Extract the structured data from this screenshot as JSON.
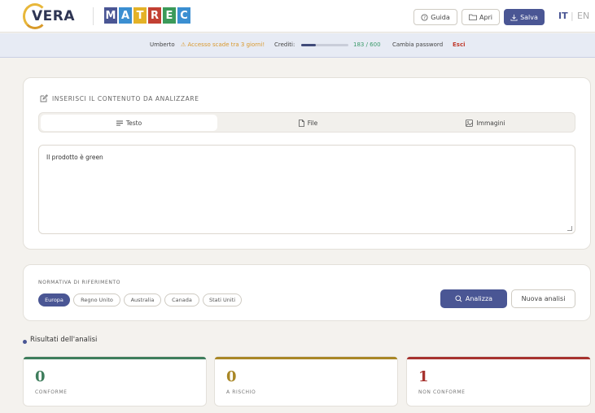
{
  "header": {
    "vera_logo_text": "VERA",
    "matrec_letters": [
      {
        "char": "M",
        "color": "#4a5694"
      },
      {
        "char": "A",
        "color": "#3b8fd1"
      },
      {
        "char": "T",
        "color": "#e4b227"
      },
      {
        "char": "R",
        "color": "#c24033"
      },
      {
        "char": "E",
        "color": "#3b9a5a"
      },
      {
        "char": "C",
        "color": "#3b8fd1"
      }
    ],
    "guida_label": "Guida",
    "apri_label": "Apri",
    "salva_label": "Salva",
    "lang_it": "IT",
    "lang_sep": "|",
    "lang_en": "EN"
  },
  "status": {
    "user": "Umberto",
    "warning": "Accesso scade tra 3 giorni!",
    "credits_label": "Crediti:",
    "credits_value": "183 / 600",
    "credits_fraction": 0.305,
    "change_password": "Cambia password",
    "logout": "Esci"
  },
  "input_section": {
    "title": "INSERISCI IL CONTENUTO DA ANALIZZARE",
    "tabs": [
      {
        "label": "Testo",
        "icon": "lines-icon",
        "active": true
      },
      {
        "label": "File",
        "icon": "file-icon",
        "active": false
      },
      {
        "label": "Immagini",
        "icon": "image-icon",
        "active": false
      }
    ],
    "text_value": "Il prodotto è green"
  },
  "normativa": {
    "title": "NORMATIVA DI RIFERIMENTO",
    "options": [
      "Europa",
      "Regno Unito",
      "Australia",
      "Canada",
      "Stati Uniti"
    ],
    "selected": "Europa",
    "analizza_label": "Analizza",
    "nuova_label": "Nuova analisi"
  },
  "results": {
    "title": "Risultati dell'analisi",
    "cards": [
      {
        "value": "0",
        "label": "CONFORME",
        "color": "#3e7d5c"
      },
      {
        "value": "0",
        "label": "A RISCHIO",
        "color": "#a98726"
      },
      {
        "value": "1",
        "label": "NON CONFORME",
        "color": "#a7332f"
      }
    ]
  },
  "colors": {
    "accent": "#4a5694",
    "warning": "#d9982c",
    "credit_value": "#3a9a6a",
    "logout": "#c0392b"
  }
}
